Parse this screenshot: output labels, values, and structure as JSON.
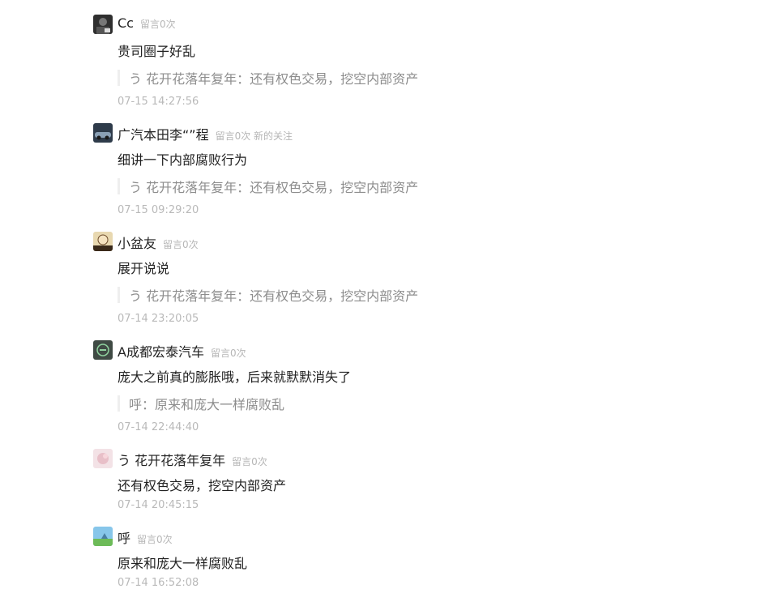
{
  "comments": [
    {
      "nickname": "Cc",
      "meta": "留言0次",
      "content": "贵司圈子好乱",
      "quote": "う 花开花落年复年：还有权色交易，挖空内部资产",
      "time": "07-15 14:27:56",
      "avatar": "dark-character-avatar"
    },
    {
      "nickname": "广汽本田李“”程",
      "meta": "留言0次 新的关注",
      "content": "细讲一下内部腐败行为",
      "quote": "う 花开花落年复年：还有权色交易，挖空内部资产",
      "time": "07-15 09:29:20",
      "avatar": "car-avatar"
    },
    {
      "nickname": "小盆友",
      "meta": "留言0次",
      "content": "展开说说",
      "quote": "う 花开花落年复年：还有权色交易，挖空内部资产",
      "time": "07-14 23:20:05",
      "avatar": "cartoon-avatar"
    },
    {
      "nickname": "A成都宏泰汽车",
      "meta": "留言0次",
      "content": "庞大之前真的膨胀哦，后来就默默消失了",
      "quote": "呼：原来和庞大一样腐败乱",
      "time": "07-14 22:44:40",
      "avatar": "logo-avatar"
    },
    {
      "nickname": "う 花开花落年复年",
      "meta": "留言0次",
      "content": "还有权色交易，挖空内部资产",
      "quote": "",
      "time": "07-14 20:45:15",
      "avatar": "pink-avatar"
    },
    {
      "nickname": "呼",
      "meta": "留言0次",
      "content": "原来和庞大一样腐败乱",
      "quote": "",
      "time": "07-14 16:52:08",
      "avatar": "landscape-avatar"
    }
  ]
}
